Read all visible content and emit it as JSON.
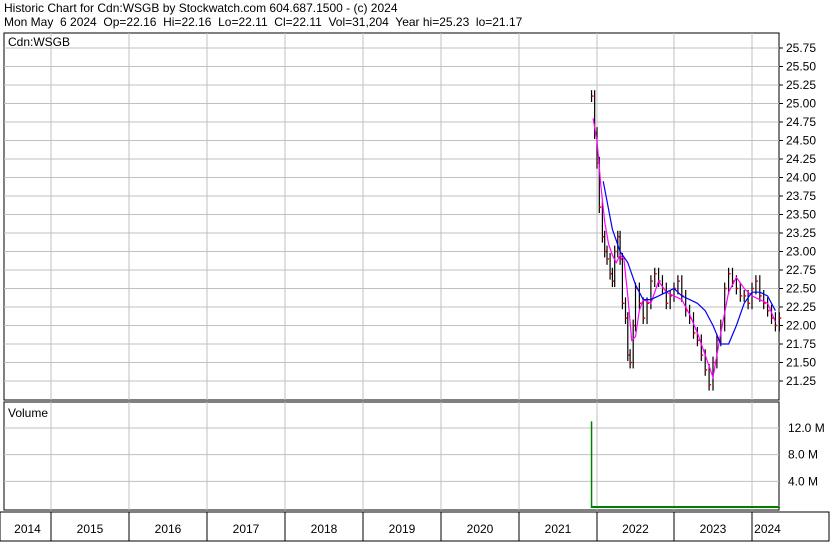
{
  "header": {
    "line1": "Historic Chart for Cdn:WSGB by Stockwatch.com 604.687.1500 - (c) 2024",
    "line2": "Mon May  6 2024  Op=22.16  Hi=22.16  Lo=22.11  Cl=22.11  Vol=31,204  Year hi=25.23  lo=21.17"
  },
  "chart_data": {
    "type": "line",
    "symbol_label": "Cdn:WSGB",
    "volume_label": "Volume",
    "x_axis": {
      "tick_labels": [
        "2014",
        "2015",
        "2016",
        "2017",
        "2018",
        "2019",
        "2020",
        "2021",
        "2022",
        "2023",
        "2024"
      ],
      "range": [
        "2014-01",
        "2024-05"
      ]
    },
    "price_axis": {
      "tick_labels": [
        "25.75",
        "25.50",
        "25.25",
        "25.00",
        "24.75",
        "24.50",
        "24.25",
        "24.00",
        "23.75",
        "23.50",
        "23.25",
        "23.00",
        "22.75",
        "22.50",
        "22.25",
        "22.00",
        "21.75",
        "21.50",
        "21.25"
      ],
      "ylim": [
        21.0,
        26.0
      ]
    },
    "volume_axis": {
      "tick_labels": [
        "12.0 M",
        "8.0 M",
        "4.0 M"
      ],
      "ylim": [
        0,
        14000000
      ]
    },
    "grid": true,
    "colors": {
      "price_bars": "#000000",
      "close_ticks": "#ff0000",
      "ma_short": "#ff00ff",
      "ma_long": "#0000ff",
      "volume": "#008000",
      "grid": "#c0c0c0"
    },
    "series": [
      {
        "key": "price",
        "x": [
          2021.93,
          2021.97,
          2022.0,
          2022.03,
          2022.07,
          2022.1,
          2022.13,
          2022.17,
          2022.2,
          2022.23,
          2022.27,
          2022.3,
          2022.33,
          2022.37,
          2022.4,
          2022.43,
          2022.47,
          2022.5,
          2022.55,
          2022.6,
          2022.65,
          2022.7,
          2022.75,
          2022.8,
          2022.85,
          2022.9,
          2022.95,
          2023.0,
          2023.05,
          2023.1,
          2023.15,
          2023.2,
          2023.25,
          2023.3,
          2023.35,
          2023.4,
          2023.45,
          2023.5,
          2023.55,
          2023.6,
          2023.65,
          2023.7,
          2023.75,
          2023.8,
          2023.85,
          2023.9,
          2023.95,
          2024.0,
          2024.05,
          2024.1,
          2024.15,
          2024.2,
          2024.25,
          2024.3,
          2024.35
        ],
        "values": [
          25.1,
          24.6,
          24.2,
          23.6,
          23.2,
          23.0,
          22.9,
          22.7,
          22.6,
          23.0,
          23.2,
          22.9,
          22.3,
          22.1,
          21.6,
          21.5,
          22.0,
          22.5,
          22.3,
          22.1,
          22.3,
          22.6,
          22.7,
          22.6,
          22.5,
          22.3,
          22.4,
          22.5,
          22.6,
          22.4,
          22.2,
          22.1,
          21.9,
          21.8,
          21.6,
          21.4,
          21.2,
          21.5,
          21.8,
          22.0,
          22.5,
          22.7,
          22.6,
          22.5,
          22.4,
          22.4,
          22.3,
          22.5,
          22.6,
          22.4,
          22.3,
          22.2,
          22.1,
          22.0,
          22.1
        ]
      },
      {
        "key": "ma_short",
        "x": [
          2021.95,
          2022.0,
          2022.05,
          2022.1,
          2022.15,
          2022.2,
          2022.25,
          2022.3,
          2022.35,
          2022.4,
          2022.45,
          2022.5,
          2022.55,
          2022.6,
          2022.7,
          2022.8,
          2022.9,
          2023.0,
          2023.1,
          2023.2,
          2023.3,
          2023.4,
          2023.5,
          2023.55,
          2023.6,
          2023.7,
          2023.8,
          2023.9,
          2024.0,
          2024.1,
          2024.2,
          2024.3
        ],
        "values": [
          24.8,
          24.5,
          23.9,
          23.4,
          23.1,
          22.95,
          22.85,
          22.95,
          22.9,
          22.4,
          21.8,
          21.85,
          22.2,
          22.35,
          22.3,
          22.6,
          22.45,
          22.4,
          22.35,
          22.15,
          21.9,
          21.6,
          21.3,
          21.6,
          21.9,
          22.45,
          22.65,
          22.5,
          22.4,
          22.35,
          22.3,
          22.05
        ]
      },
      {
        "key": "ma_long",
        "x": [
          2022.08,
          2022.2,
          2022.3,
          2022.4,
          2022.5,
          2022.6,
          2022.7,
          2022.8,
          2022.9,
          2023.0,
          2023.1,
          2023.2,
          2023.3,
          2023.4,
          2023.5,
          2023.6,
          2023.7,
          2023.8,
          2023.9,
          2024.0,
          2024.1,
          2024.2,
          2024.3
        ],
        "values": [
          23.95,
          23.3,
          23.0,
          22.85,
          22.55,
          22.35,
          22.35,
          22.4,
          22.45,
          22.5,
          22.4,
          22.35,
          22.3,
          22.2,
          22.0,
          21.75,
          21.75,
          22.0,
          22.3,
          22.45,
          22.45,
          22.4,
          22.2
        ]
      }
    ],
    "volume": {
      "x": [
        2021.93,
        2022.0,
        2022.5,
        2023.0,
        2023.5,
        2024.0,
        2024.35
      ],
      "values": [
        13000000,
        150000,
        150000,
        150000,
        150000,
        150000,
        150000
      ]
    }
  }
}
